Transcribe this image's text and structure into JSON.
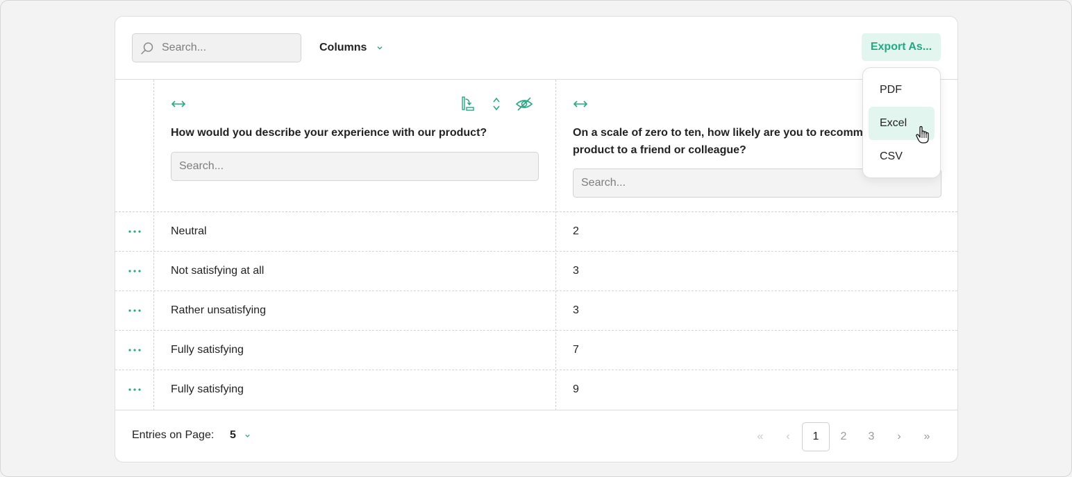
{
  "toolbar": {
    "search_placeholder": "Search...",
    "columns_label": "Columns",
    "export_label": "Export As..."
  },
  "export_menu": {
    "items": [
      "PDF",
      "Excel",
      "CSV"
    ],
    "hovered": "Excel"
  },
  "table": {
    "columns": [
      {
        "title": "How would you describe your experience with our product?",
        "filter_placeholder": "Search..."
      },
      {
        "title_line1": "On a scale of zero to ten, how likely are you to recomm",
        "title_line2": "product to a friend or colleague?",
        "filter_placeholder": "Search..."
      }
    ],
    "rows": [
      {
        "answer": "Neutral",
        "score": "2"
      },
      {
        "answer": "Not satisfying at all",
        "score": "3"
      },
      {
        "answer": "Rather unsatisfying",
        "score": "3"
      },
      {
        "answer": "Fully satisfying",
        "score": "7"
      },
      {
        "answer": "Fully satisfying",
        "score": "9"
      }
    ]
  },
  "footer": {
    "entries_label": "Entries on Page:",
    "entries_value": "5",
    "pages": [
      "1",
      "2",
      "3"
    ],
    "current_page": "1",
    "first_glyph": "«",
    "prev_glyph": "‹",
    "next_glyph": "›",
    "last_glyph": "»"
  },
  "colors": {
    "accent": "#23a882",
    "accent_bg": "#e2f5ef"
  }
}
